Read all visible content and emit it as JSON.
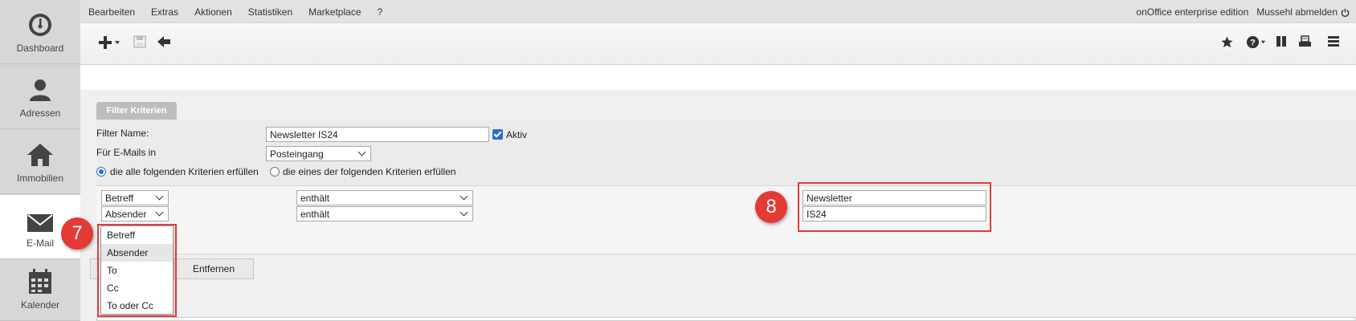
{
  "sidebar": {
    "items": [
      {
        "label": "Dashboard",
        "icon": "dashboard-icon"
      },
      {
        "label": "Adressen",
        "icon": "person-icon"
      },
      {
        "label": "Immobilien",
        "icon": "house-icon"
      },
      {
        "label": "E-Mail",
        "icon": "envelope-icon"
      },
      {
        "label": "Kalender",
        "icon": "calendar-icon"
      }
    ]
  },
  "menu": {
    "items": [
      "Bearbeiten",
      "Extras",
      "Aktionen",
      "Statistiken",
      "Marketplace",
      "?"
    ],
    "edition": "onOffice enterprise edition",
    "logout": "Mussehl abmelden"
  },
  "filter": {
    "tab_label": "Filter Kriterien",
    "name_label": "Filter Name:",
    "name_value": "Newsletter IS24",
    "aktiv_label": "Aktiv",
    "folder_label": "Für E-Mails in",
    "folder_value": "Posteingang",
    "radio_all": "die alle folgenden Kriterien erfüllen",
    "radio_any": "die eines der folgenden Kriterien erfüllen"
  },
  "criteria": {
    "rows": [
      {
        "field": "Betreff",
        "operator": "enthält",
        "value": "Newsletter"
      },
      {
        "field": "Absender",
        "operator": "enthält",
        "value": "IS24"
      }
    ]
  },
  "dropdown": {
    "options": [
      "Betreff",
      "Absender",
      "To",
      "Cc",
      "To oder Cc"
    ],
    "highlighted": "Absender"
  },
  "buttons": {
    "remove": "Entfernen"
  },
  "badges": {
    "seven": "7",
    "eight": "8"
  },
  "colors": {
    "accent": "#2b6fd6",
    "badge": "#e53935",
    "highlight_border": "#e03c3c"
  }
}
